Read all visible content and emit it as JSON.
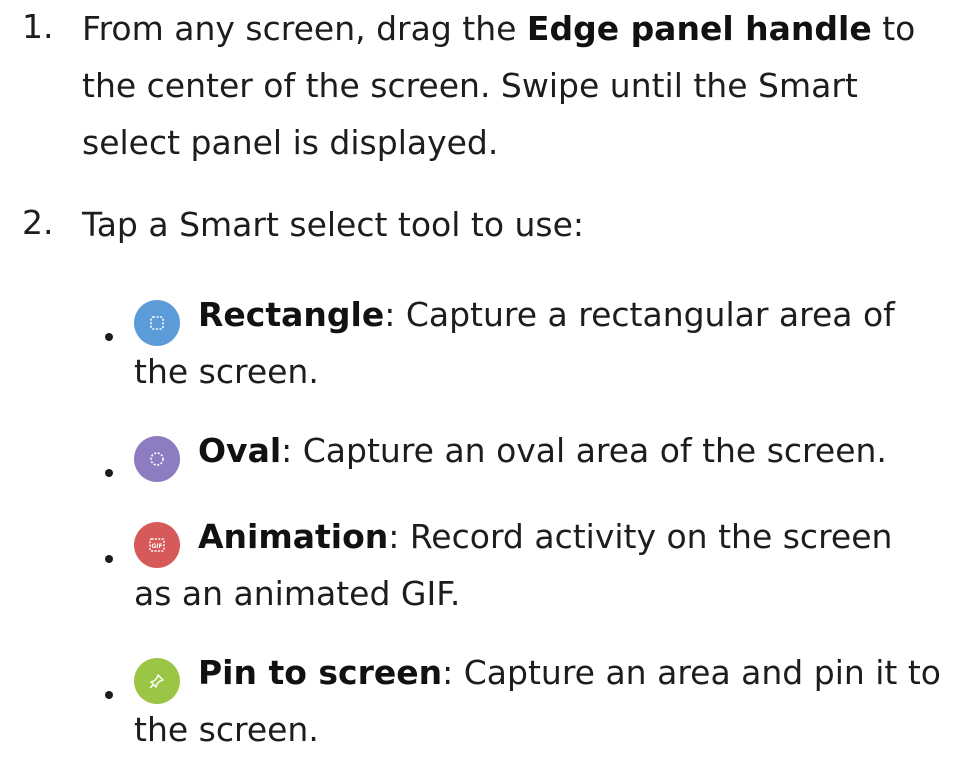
{
  "steps": [
    {
      "number": "1.",
      "lines": [
        {
          "pre": "From any screen, drag the ",
          "bold": "Edge panel handle",
          "post": " to"
        },
        {
          "text": "the center of the screen. Swipe until the Smart"
        },
        {
          "text": "select panel is displayed."
        }
      ]
    },
    {
      "number": "2.",
      "lines": [
        {
          "text": "Tap a Smart select tool to use:"
        }
      ]
    }
  ],
  "tools": [
    {
      "icon": "rectangle-select-icon",
      "color": "#5b9bd8",
      "name": "Rectangle",
      "line1": ": Capture a rectangular area of",
      "line2": "the screen."
    },
    {
      "icon": "oval-select-icon",
      "color": "#8e7cc0",
      "name": "Oval",
      "line1": ": Capture an oval area of the screen.",
      "line2": ""
    },
    {
      "icon": "animation-gif-icon",
      "color": "#d65a5a",
      "name": "Animation",
      "line1": ": Record activity on the screen",
      "line2": "as an animated GIF."
    },
    {
      "icon": "pin-icon",
      "color": "#9bc545",
      "name": "Pin to screen",
      "line1": ": Capture an area and pin it to",
      "line2": "the screen."
    }
  ]
}
